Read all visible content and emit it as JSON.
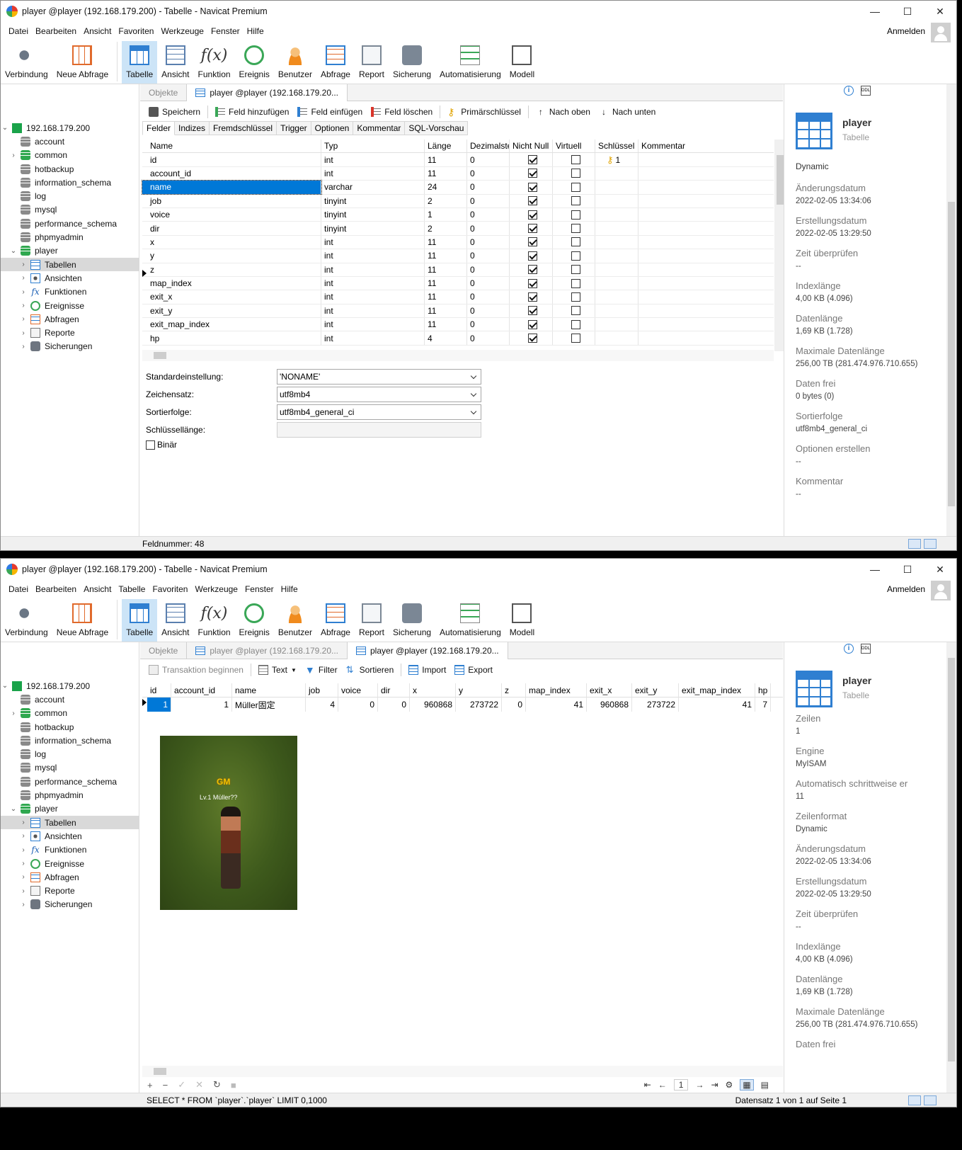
{
  "w1": {
    "title": "player @player (192.168.179.200) - Tabelle - Navicat Premium",
    "menu": [
      "Datei",
      "Bearbeiten",
      "Ansicht",
      "Favoriten",
      "Werkzeuge",
      "Fenster",
      "Hilfe"
    ],
    "login": "Anmelden",
    "toolbar": [
      "Verbindung",
      "Neue Abfrage",
      "Tabelle",
      "Ansicht",
      "Funktion",
      "Ereignis",
      "Benutzer",
      "Abfrage",
      "Report",
      "Sicherung",
      "Automatisierung",
      "Modell"
    ],
    "tabs": [
      "Objekte",
      "player @player (192.168.179.20..."
    ],
    "subtoolbar": [
      "Speichern",
      "Feld hinzufügen",
      "Feld einfügen",
      "Feld löschen",
      "Primärschlüssel",
      "Nach oben",
      "Nach unten"
    ],
    "innertabs": [
      "Felder",
      "Indizes",
      "Fremdschlüssel",
      "Trigger",
      "Optionen",
      "Kommentar",
      "SQL-Vorschau"
    ],
    "field_headers": [
      "Name",
      "Typ",
      "Länge",
      "Dezimalste",
      "Nicht Null",
      "Virtuell",
      "Schlüssel",
      "Kommentar"
    ],
    "fields": [
      {
        "name": "id",
        "type": "int",
        "len": "11",
        "dec": "0",
        "notnull": true,
        "virtual": false,
        "key": "1"
      },
      {
        "name": "account_id",
        "type": "int",
        "len": "11",
        "dec": "0",
        "notnull": true,
        "virtual": false,
        "key": ""
      },
      {
        "name": "name",
        "type": "varchar",
        "len": "24",
        "dec": "0",
        "notnull": true,
        "virtual": false,
        "key": ""
      },
      {
        "name": "job",
        "type": "tinyint",
        "len": "2",
        "dec": "0",
        "notnull": true,
        "virtual": false,
        "key": ""
      },
      {
        "name": "voice",
        "type": "tinyint",
        "len": "1",
        "dec": "0",
        "notnull": true,
        "virtual": false,
        "key": ""
      },
      {
        "name": "dir",
        "type": "tinyint",
        "len": "2",
        "dec": "0",
        "notnull": true,
        "virtual": false,
        "key": ""
      },
      {
        "name": "x",
        "type": "int",
        "len": "11",
        "dec": "0",
        "notnull": true,
        "virtual": false,
        "key": ""
      },
      {
        "name": "y",
        "type": "int",
        "len": "11",
        "dec": "0",
        "notnull": true,
        "virtual": false,
        "key": ""
      },
      {
        "name": "z",
        "type": "int",
        "len": "11",
        "dec": "0",
        "notnull": true,
        "virtual": false,
        "key": ""
      },
      {
        "name": "map_index",
        "type": "int",
        "len": "11",
        "dec": "0",
        "notnull": true,
        "virtual": false,
        "key": ""
      },
      {
        "name": "exit_x",
        "type": "int",
        "len": "11",
        "dec": "0",
        "notnull": true,
        "virtual": false,
        "key": ""
      },
      {
        "name": "exit_y",
        "type": "int",
        "len": "11",
        "dec": "0",
        "notnull": true,
        "virtual": false,
        "key": ""
      },
      {
        "name": "exit_map_index",
        "type": "int",
        "len": "11",
        "dec": "0",
        "notnull": true,
        "virtual": false,
        "key": ""
      },
      {
        "name": "hp",
        "type": "int",
        "len": "4",
        "dec": "0",
        "notnull": true,
        "virtual": false,
        "key": ""
      }
    ],
    "props": [
      {
        "label": "Standardeinstellung:",
        "value": "'NONAME'"
      },
      {
        "label": "Zeichensatz:",
        "value": "utf8mb4"
      },
      {
        "label": "Sortierfolge:",
        "value": "utf8mb4_general_ci"
      },
      {
        "label": "Schlüssellänge:",
        "value": ""
      }
    ],
    "binary_label": "Binär",
    "status": "Feldnummer: 48",
    "info": {
      "name": "player",
      "type": "Tabelle",
      "first": "Dynamic",
      "items": [
        {
          "k": "Änderungsdatum",
          "v": "2022-02-05 13:34:06"
        },
        {
          "k": "Erstellungsdatum",
          "v": "2022-02-05 13:29:50"
        },
        {
          "k": "Zeit überprüfen",
          "v": "--"
        },
        {
          "k": "Indexlänge",
          "v": "4,00 KB (4.096)"
        },
        {
          "k": "Datenlänge",
          "v": "1,69 KB (1.728)"
        },
        {
          "k": "Maximale Datenlänge",
          "v": "256,00 TB (281.474.976.710.655)"
        },
        {
          "k": "Daten frei",
          "v": "0 bytes (0)"
        },
        {
          "k": "Sortierfolge",
          "v": "utf8mb4_general_ci"
        },
        {
          "k": "Optionen erstellen",
          "v": "--"
        },
        {
          "k": "Kommentar",
          "v": "--"
        }
      ]
    }
  },
  "w2": {
    "title": "player @player (192.168.179.200) - Tabelle - Navicat Premium",
    "menu": [
      "Datei",
      "Bearbeiten",
      "Ansicht",
      "Tabelle",
      "Favoriten",
      "Werkzeuge",
      "Fenster",
      "Hilfe"
    ],
    "login": "Anmelden",
    "tabs": [
      "Objekte",
      "player @player (192.168.179.20...",
      "player @player (192.168.179.20..."
    ],
    "subtoolbar": [
      "Transaktion beginnen",
      "Text",
      "Filter",
      "Sortieren",
      "Import",
      "Export"
    ],
    "data_headers": [
      "id",
      "account_id",
      "name",
      "job",
      "voice",
      "dir",
      "x",
      "y",
      "z",
      "map_index",
      "exit_x",
      "exit_y",
      "exit_map_index",
      "hp"
    ],
    "data_row": [
      "1",
      "1",
      "Müller固定",
      "4",
      "0",
      "0",
      "960868",
      "273722",
      "0",
      "41",
      "960868",
      "273722",
      "41",
      "7"
    ],
    "game": {
      "badge": "GM",
      "label": "Lv.1 Müller??"
    },
    "page_number": "1",
    "status_sql": "SELECT * FROM `player`.`player` LIMIT 0,1000",
    "status_record": "Datensatz 1 von 1 auf Seite 1",
    "info": {
      "name": "player",
      "type": "Tabelle",
      "items": [
        {
          "k": "Zeilen",
          "v": "1"
        },
        {
          "k": "Engine",
          "v": "MyISAM"
        },
        {
          "k": "Automatisch schrittweise er",
          "v": "11"
        },
        {
          "k": "Zeilenformat",
          "v": "Dynamic"
        },
        {
          "k": "Änderungsdatum",
          "v": "2022-02-05 13:34:06"
        },
        {
          "k": "Erstellungsdatum",
          "v": "2022-02-05 13:29:50"
        },
        {
          "k": "Zeit überprüfen",
          "v": "--"
        },
        {
          "k": "Indexlänge",
          "v": "4,00 KB (4.096)"
        },
        {
          "k": "Datenlänge",
          "v": "1,69 KB (1.728)"
        },
        {
          "k": "Maximale Datenlänge",
          "v": "256,00 TB (281.474.976.710.655)"
        },
        {
          "k": "Daten frei",
          "v": ""
        }
      ]
    }
  },
  "tree": {
    "connection": "192.168.179.200",
    "dbs": [
      "account",
      "common",
      "hotbackup",
      "information_schema",
      "log",
      "mysql",
      "performance_schema",
      "phpmyadmin",
      "player"
    ],
    "player_children": [
      "Tabellen",
      "Ansichten",
      "Funktionen",
      "Ereignisse",
      "Abfragen",
      "Reporte",
      "Sicherungen"
    ]
  }
}
